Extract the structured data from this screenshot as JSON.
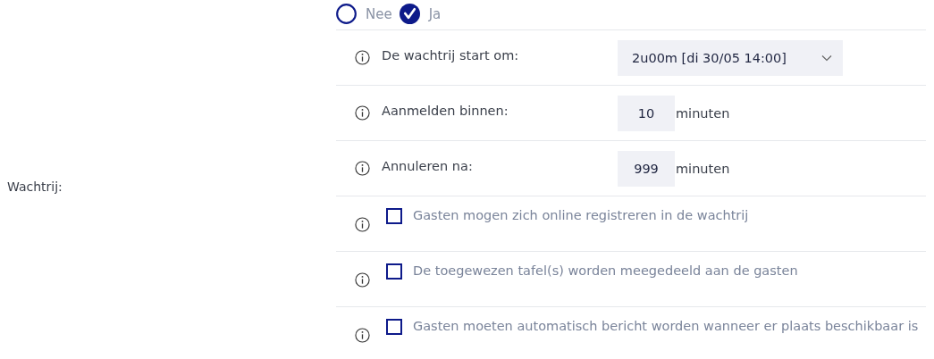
{
  "field_label": "Wachtrij:",
  "radios": [
    {
      "label": "Nee",
      "selected": false
    },
    {
      "label": "Ja",
      "selected": true
    }
  ],
  "settings": [
    {
      "kind": "select",
      "label": "De wachtrij start om:",
      "value": "2u00m [di 30/05 14:00]"
    },
    {
      "kind": "number",
      "label": "Aanmelden binnen:",
      "value": "10",
      "unit": "minuten"
    },
    {
      "kind": "number",
      "label": "Annuleren na:",
      "value": "999",
      "unit": "minuten"
    },
    {
      "kind": "checkbox",
      "label": "Gasten mogen zich online registreren in de wachtrij",
      "checked": false
    },
    {
      "kind": "checkbox",
      "label": "De toegewezen tafel(s) worden meegedeeld aan de gasten",
      "checked": false
    },
    {
      "kind": "checkbox",
      "label": "Gasten moeten automatisch bericht worden wanneer er plaats beschikbaar is",
      "checked": false
    }
  ]
}
